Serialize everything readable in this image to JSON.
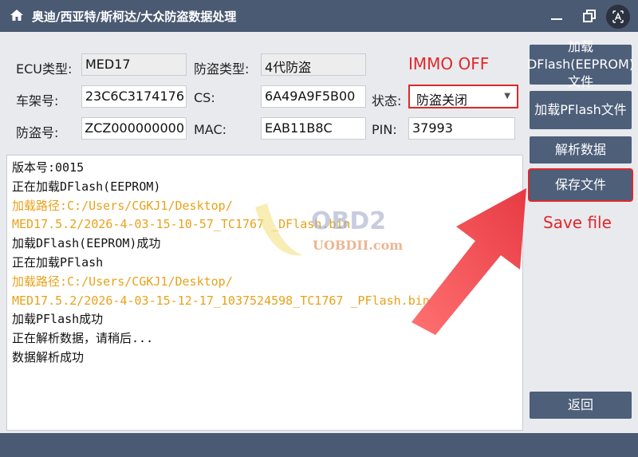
{
  "window": {
    "title": "奥迪/西亚特/斯柯达/大众防盗数据处理",
    "home_icon": "home-icon",
    "minimize_icon": "minimize-icon",
    "maximize_icon": "restore-icon",
    "close_icon": "close-icon"
  },
  "form": {
    "ecu_type_label": "ECU类型:",
    "ecu_type_value": "MED17",
    "immo_type_label": "防盗类型:",
    "immo_type_value": "4代防盗",
    "vin_label": "车架号:",
    "vin_value": "23C6C3174176",
    "cs_label": "CS:",
    "cs_value": "6A49A9F5B00",
    "status_label": "状态:",
    "status_value": "防盗关闭",
    "immo_no_label": "防盗号:",
    "immo_no_value": "ZCZ000000000",
    "mac_label": "MAC:",
    "mac_value": "EAB11B8C",
    "pin_label": "PIN:",
    "pin_value": "37993"
  },
  "annotations": {
    "immo_off": "IMMO OFF",
    "save_file": "Save file"
  },
  "buttons": {
    "load_dflash": "加载DFlash(EEPROM)文件",
    "load_pflash": "加载PFlash文件",
    "parse_data": "解析数据",
    "save_file": "保存文件",
    "back": "返回"
  },
  "log": [
    {
      "text": "版本号:0015",
      "color": "black"
    },
    {
      "text": "正在加载DFlash(EEPROM)",
      "color": "black"
    },
    {
      "text": "加载路径:C:/Users/CGKJ1/Desktop/",
      "color": "orange"
    },
    {
      "text": "MED17.5.2/2026-4-03-15-10-57_TC1767 _DFlash.bin",
      "color": "orange"
    },
    {
      "text": "加载DFlash(EEPROM)成功",
      "color": "black"
    },
    {
      "text": "正在加载PFlash",
      "color": "black"
    },
    {
      "text": "加载路径:C:/Users/CGKJ1/Desktop/",
      "color": "orange"
    },
    {
      "text": "MED17.5.2/2026-4-03-15-12-17_1037524598_TC1767 _PFlash.bin",
      "color": "orange"
    },
    {
      "text": "加载PFlash成功",
      "color": "black"
    },
    {
      "text": "正在解析数据，请稍后...",
      "color": "black"
    },
    {
      "text": "数据解析成功",
      "color": "black"
    }
  ],
  "watermark": {
    "brand": "OBD2",
    "site": "UOBDII.com"
  },
  "colors": {
    "titlebar": "#4a5a72",
    "button": "#4d5f79",
    "highlight_red": "#e0282a",
    "log_orange": "#e8a21a"
  }
}
